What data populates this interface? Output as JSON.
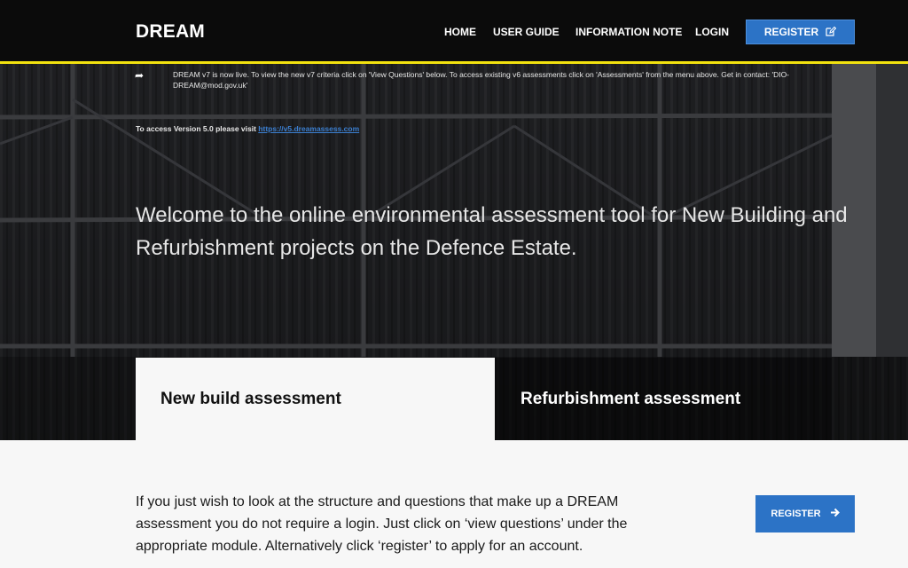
{
  "brand": "DREAM",
  "nav": {
    "home": "HOME",
    "user_guide": "USER GUIDE",
    "information_note": "INFORMATION NOTE",
    "login": "LOGIN",
    "register": "REGISTER",
    "register_icon": "edit-icon"
  },
  "announcement": {
    "icon": "share-icon",
    "text": "DREAM v7 is now live. To view the new v7 criteria click on 'View Questions' below. To access existing v6 assessments click on 'Assessments' from the menu above. Get in contact: 'DIO-DREAM@mod.gov.uk'"
  },
  "version_notice": {
    "prefix": "To access Version 5.0 please visit ",
    "link": "https://v5.dreamassess.com"
  },
  "hero": {
    "welcome": "Welcome to the online environmental assessment tool for New Building and Refurbishment projects on the Defence Estate."
  },
  "tabs": [
    {
      "label": "New build assessment",
      "active": true
    },
    {
      "label": "Refurbishment assessment",
      "active": false
    }
  ],
  "content": {
    "intro": "If you just wish to look at the structure and questions that make up a DREAM assessment you do not require a login. Just click on ‘view questions’ under the appropriate module. Alternatively click ‘register’ to apply for an account.",
    "register_button": "REGISTER",
    "register_icon": "arrow-right-icon"
  },
  "colors": {
    "accent": "#2c73c6",
    "topbar": "#0b0b0b",
    "highlight_line": "#f2e20f"
  }
}
